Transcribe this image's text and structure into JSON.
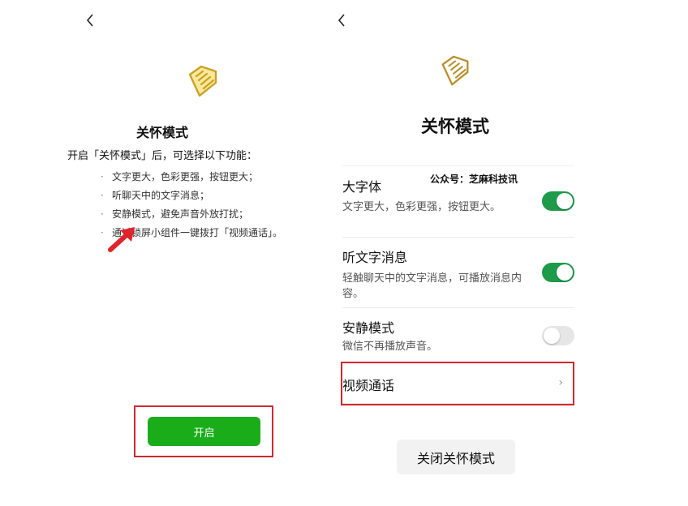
{
  "colors": {
    "accent_green": "#1aad19",
    "toggle_on": "#1d9b4a",
    "highlight_red": "#d0282e",
    "logo_gold": "#c9a227"
  },
  "left": {
    "back_icon": "chevron-left-icon",
    "logo_icon": "heart-hand-icon",
    "title": "关怀模式",
    "intro": "开启「关怀模式」后，可选择以下功能：",
    "features": [
      {
        "bullet": "·",
        "text": "文字更大，色彩更强，按钮更大；"
      },
      {
        "bullet": "·",
        "text": "听聊天中的文字消息；"
      },
      {
        "bullet": "·",
        "text": "安静模式，避免声音外放打扰；"
      },
      {
        "bullet": "·",
        "text": "通过锁屏小组件一键拨打「视频通话」。"
      }
    ],
    "enable_button": "开启"
  },
  "right": {
    "back_icon": "chevron-left-icon",
    "logo_icon": "heart-hand-icon",
    "title": "关怀模式",
    "watermark": "公众号：芝麻科技讯",
    "settings": [
      {
        "title": "大字体",
        "desc": "文字更大，色彩更强，按钮更大。",
        "toggle": "on"
      },
      {
        "title": "听文字消息",
        "desc": "轻触聊天中的文字消息，可播放消息内容。",
        "toggle": "on"
      },
      {
        "title": "安静模式",
        "desc": "微信不再播放声音。",
        "toggle": "off"
      }
    ],
    "video_call": {
      "label": "视频通话",
      "chevron": "›"
    },
    "close_button": "关闭关怀模式"
  }
}
